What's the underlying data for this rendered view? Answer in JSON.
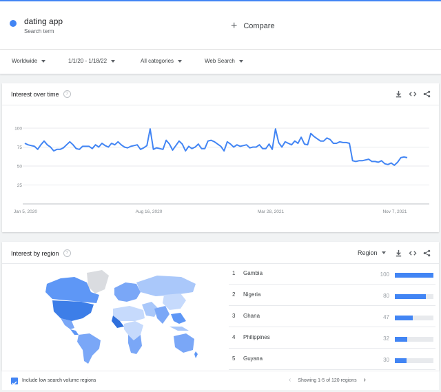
{
  "search": {
    "term": "dating app",
    "subtitle": "Search term",
    "compare_label": "Compare"
  },
  "filters": {
    "region": "Worldwide",
    "date_range": "1/1/20 - 1/18/22",
    "category": "All categories",
    "search_type": "Web Search"
  },
  "interest_over_time": {
    "title": "Interest over time"
  },
  "interest_by_region": {
    "title": "Interest by region",
    "region_select": "Region",
    "rows": [
      {
        "rank": "1",
        "name": "Gambia",
        "value": "100"
      },
      {
        "rank": "2",
        "name": "Nigeria",
        "value": "80"
      },
      {
        "rank": "3",
        "name": "Ghana",
        "value": "47"
      },
      {
        "rank": "4",
        "name": "Philippines",
        "value": "32"
      },
      {
        "rank": "5",
        "name": "Guyana",
        "value": "30"
      }
    ]
  },
  "footer": {
    "checkbox_label": "Include low search volume regions",
    "pagination": "Showing 1-5 of 120 regions"
  },
  "colors": {
    "series": "#4285f4",
    "map_high": "#5e97f6",
    "map_low": "#c6dafc"
  },
  "chart_data": {
    "type": "line",
    "title": "Interest over time",
    "series": [
      {
        "name": "dating app",
        "color": "#4285f4",
        "values": [
          80,
          78,
          77,
          76,
          72,
          78,
          83,
          78,
          75,
          70,
          72,
          72,
          74,
          78,
          82,
          78,
          73,
          72,
          76,
          76,
          76,
          73,
          78,
          75,
          80,
          77,
          75,
          80,
          78,
          82,
          78,
          75,
          74,
          76,
          77,
          78,
          72,
          74,
          77,
          99,
          72,
          74,
          73,
          72,
          84,
          79,
          71,
          77,
          83,
          79,
          70,
          76,
          73,
          75,
          79,
          73,
          73,
          83,
          84,
          82,
          79,
          76,
          70,
          82,
          79,
          75,
          78,
          76,
          77,
          78,
          74,
          75,
          75,
          78,
          73,
          73,
          79,
          72,
          99,
          81,
          75,
          82,
          80,
          78,
          83,
          80,
          88,
          79,
          78,
          93,
          89,
          86,
          83,
          83,
          87,
          85,
          80,
          80,
          82,
          81,
          81,
          80,
          57,
          56,
          57,
          57,
          58,
          59,
          56,
          56,
          55,
          57,
          53,
          52,
          54,
          51,
          55,
          61,
          62,
          61
        ]
      }
    ],
    "x_ticks": [
      "Jan 5, 2020",
      "Aug 16, 2020",
      "Mar 28, 2021",
      "Nov 7, 2021"
    ],
    "y_ticks": [
      100,
      75,
      50,
      25
    ],
    "ylim": [
      0,
      100
    ],
    "grid": true
  }
}
